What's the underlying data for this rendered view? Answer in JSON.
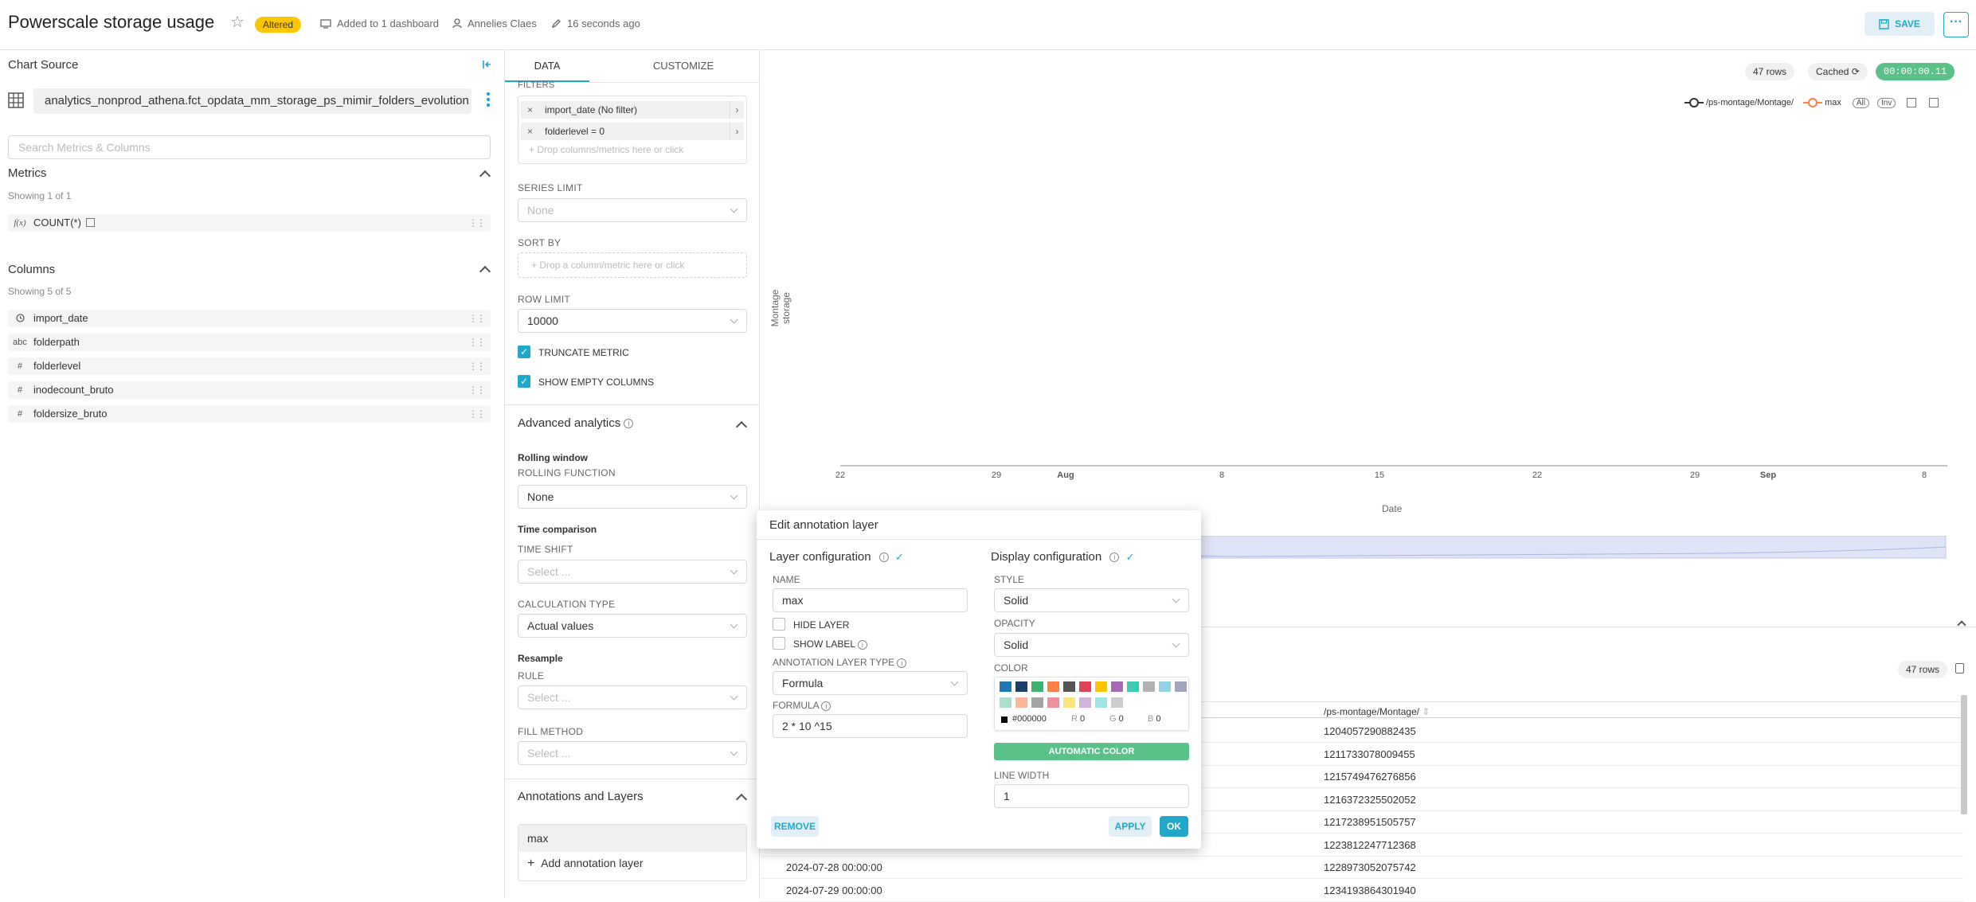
{
  "header": {
    "title": "Powerscale storage usage",
    "altered_badge": "Altered",
    "dashboards": "Added to 1 dashboard",
    "owner": "Annelies Claes",
    "modified": "16 seconds ago",
    "save_label": "SAVE",
    "more_label": "···"
  },
  "left_panel": {
    "title": "Chart Source",
    "dataset": "analytics_nonprod_athena.fct_opdata_mm_storage_ps_mimir_folders_evolution",
    "search_placeholder": "Search Metrics & Columns",
    "metrics": {
      "heading": "Metrics",
      "showing": "Showing 1 of 1",
      "items": [
        {
          "icon": "f(x)",
          "label": "COUNT(*)"
        }
      ]
    },
    "columns": {
      "heading": "Columns",
      "showing": "Showing 5 of 5",
      "items": [
        {
          "icon": "clock",
          "label": "import_date"
        },
        {
          "icon": "abc",
          "label": "folderpath"
        },
        {
          "icon": "#",
          "label": "folderlevel"
        },
        {
          "icon": "#",
          "label": "inodecount_bruto"
        },
        {
          "icon": "#",
          "label": "foldersize_bruto"
        }
      ]
    }
  },
  "middle_panel": {
    "tabs": [
      {
        "label": "DATA"
      },
      {
        "label": "CUSTOMIZE"
      }
    ],
    "filters_label": "FILTERS",
    "filters": [
      {
        "label": "import_date (No filter)"
      },
      {
        "label": "folderlevel = 0"
      }
    ],
    "filters_drop": "Drop columns/metrics here or click",
    "series_limit": {
      "label": "SERIES LIMIT",
      "value": "None"
    },
    "sort_by": {
      "label": "SORT BY",
      "drop": "Drop a column/metric here or click"
    },
    "row_limit": {
      "label": "ROW LIMIT",
      "value": "10000"
    },
    "truncate_metric": "TRUNCATE METRIC",
    "show_empty_columns": "SHOW EMPTY COLUMNS",
    "advanced": {
      "heading": "Advanced analytics",
      "rolling_window": "Rolling window",
      "rolling_function_label": "ROLLING FUNCTION",
      "rolling_function_value": "None",
      "time_comparison": "Time comparison",
      "time_shift_label": "TIME SHIFT",
      "time_shift_placeholder": "Select ...",
      "calc_type_label": "CALCULATION TYPE",
      "calc_type_value": "Actual values",
      "resample": "Resample",
      "rule_label": "RULE",
      "rule_placeholder": "Select ...",
      "fill_label": "FILL METHOD",
      "fill_placeholder": "Select ..."
    },
    "annotations": {
      "heading": "Annotations and Layers",
      "items": [
        {
          "label": "max"
        }
      ],
      "add_label": "Add annotation layer"
    }
  },
  "chart": {
    "rows_badge": "47 rows",
    "cached_badge": "Cached",
    "timer": "00:00:00.11",
    "legend": [
      {
        "label": "/ps-montage/Montage/",
        "color": "#333333"
      },
      {
        "label": "max",
        "color": "#ff7f44"
      }
    ],
    "legend_all": "All",
    "legend_inv": "Inv",
    "y_label": "Montage storage",
    "x_label": "Date",
    "x_ticks": [
      "22",
      "29",
      "Aug",
      "8",
      "15",
      "22",
      "29",
      "Sep",
      "8"
    ]
  },
  "table": {
    "rows_badge": "47 rows",
    "column_header": "/ps-montage/Montage/",
    "rows": [
      {
        "date": "",
        "value": "1204057290882435"
      },
      {
        "date": "",
        "value": "1211733078009455"
      },
      {
        "date": "",
        "value": "1215749476276856"
      },
      {
        "date": "",
        "value": "1216372325502052"
      },
      {
        "date": "",
        "value": "1217238951505757"
      },
      {
        "date": "",
        "value": "1223812247712368"
      },
      {
        "date": "2024-07-28 00:00:00",
        "value": "1228973052075742"
      },
      {
        "date": "2024-07-29 00:00:00",
        "value": "1234193864301940"
      }
    ]
  },
  "modal": {
    "title": "Edit annotation layer",
    "layer_config": "Layer configuration",
    "display_config": "Display configuration",
    "name_label": "NAME",
    "name_value": "max",
    "hide_layer": "HIDE LAYER",
    "show_label": "SHOW LABEL",
    "type_label": "ANNOTATION LAYER TYPE",
    "type_value": "Formula",
    "formula_label": "FORMULA",
    "formula_value": "2 * 10 ^15",
    "style_label": "STYLE",
    "style_value": "Solid",
    "opacity_label": "OPACITY",
    "opacity_value": "Solid",
    "color_label": "COLOR",
    "swatches": [
      "#1f77b4",
      "#1a3f6b",
      "#3cb371",
      "#ff7f44",
      "#555555",
      "#e04355",
      "#fcc700",
      "#a868b7",
      "#3cccb4",
      "#b2b2b2",
      "#8fd3e4",
      "#a1a6bd",
      "#acdfcb",
      "#fdb59b",
      "#a4a4a4",
      "#ef8f9d",
      "#fce480",
      "#d3b3da",
      "#9ee5e5",
      "#cccccc"
    ],
    "hex_value": "#000000",
    "r_label": "R",
    "r_value": "0",
    "g_label": "G",
    "g_value": "0",
    "b_label": "B",
    "b_value": "0",
    "automatic_color": "AUTOMATIC COLOR",
    "line_width_label": "LINE WIDTH",
    "line_width_value": "1",
    "remove": "REMOVE",
    "apply": "APPLY",
    "ok": "OK"
  }
}
